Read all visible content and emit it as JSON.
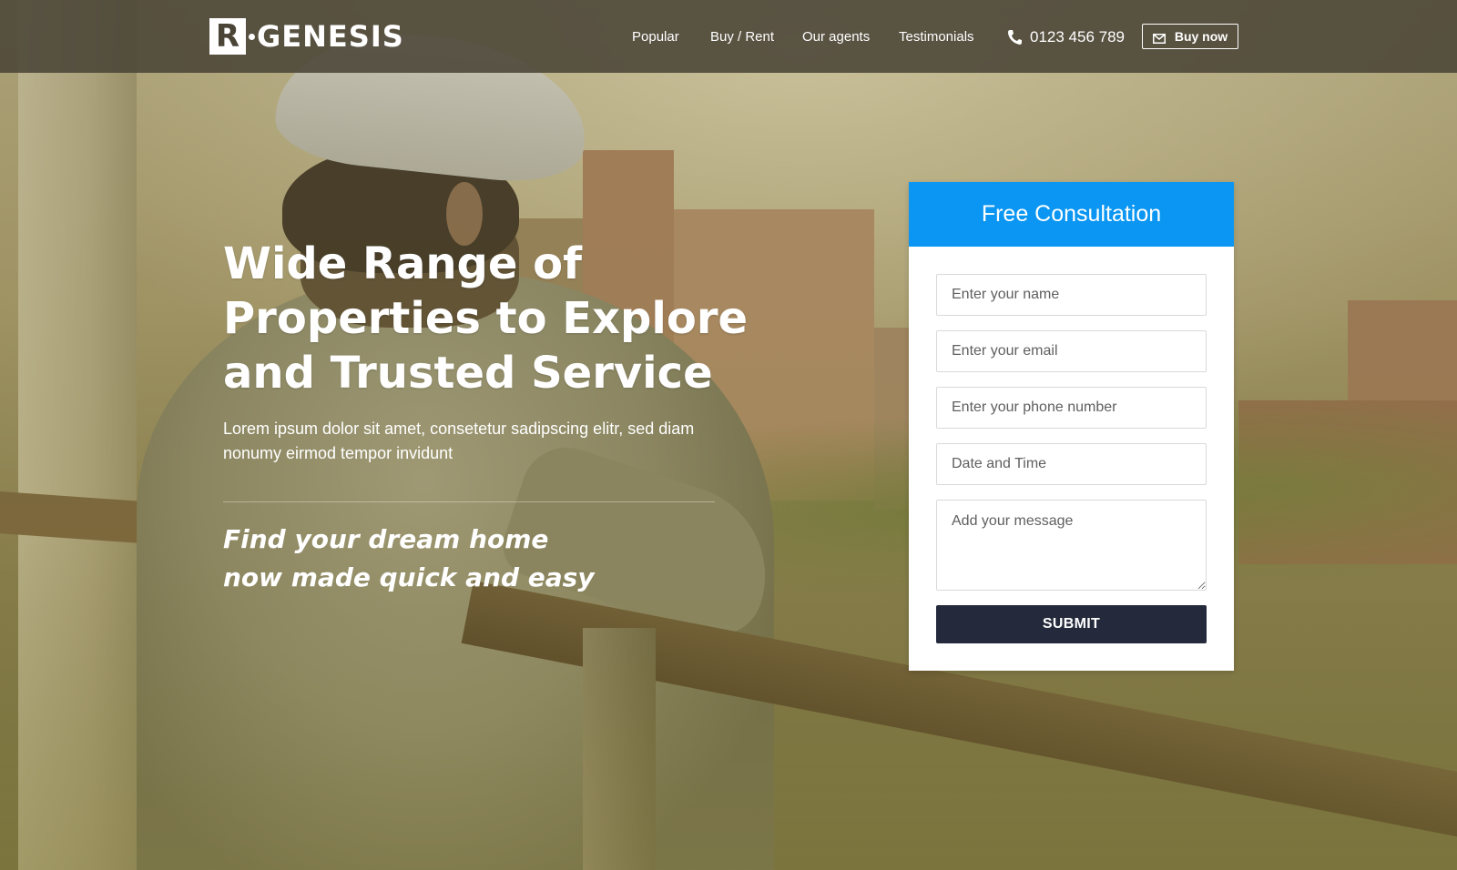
{
  "brand": {
    "logo_mark": "R",
    "logo_text": "GENESIS"
  },
  "nav": {
    "links": [
      "Popular",
      "Buy / Rent",
      "Our agents",
      "Testimonials"
    ],
    "phone": "0123 456 789",
    "buy_button": "Buy now"
  },
  "hero": {
    "headline": "Wide Range of Properties to Explore and Trusted Service",
    "headline_lines": [
      "Wide Range of",
      "Properties to Explore",
      "and Trusted Service"
    ],
    "subtext": "Lorem ipsum dolor sit amet, consetetur sadipscing elitr, sed diam nonumy eirmod tempor invidunt",
    "tagline_lines": [
      "Find your dream home",
      "now made quick and easy"
    ]
  },
  "form": {
    "title": "Free Consultation",
    "name_placeholder": "Enter your name",
    "email_placeholder": "Enter your email",
    "phone_placeholder": "Enter your phone number",
    "date_placeholder": "Date and Time",
    "message_placeholder": "Add your message",
    "submit_label": "SUBMIT"
  },
  "colors": {
    "navbar_bg": "#4a4437",
    "form_header": "#0a96f2",
    "submit_bg": "#242a3b"
  },
  "icons": {
    "phone": "phone-icon",
    "mail": "mail-icon"
  }
}
